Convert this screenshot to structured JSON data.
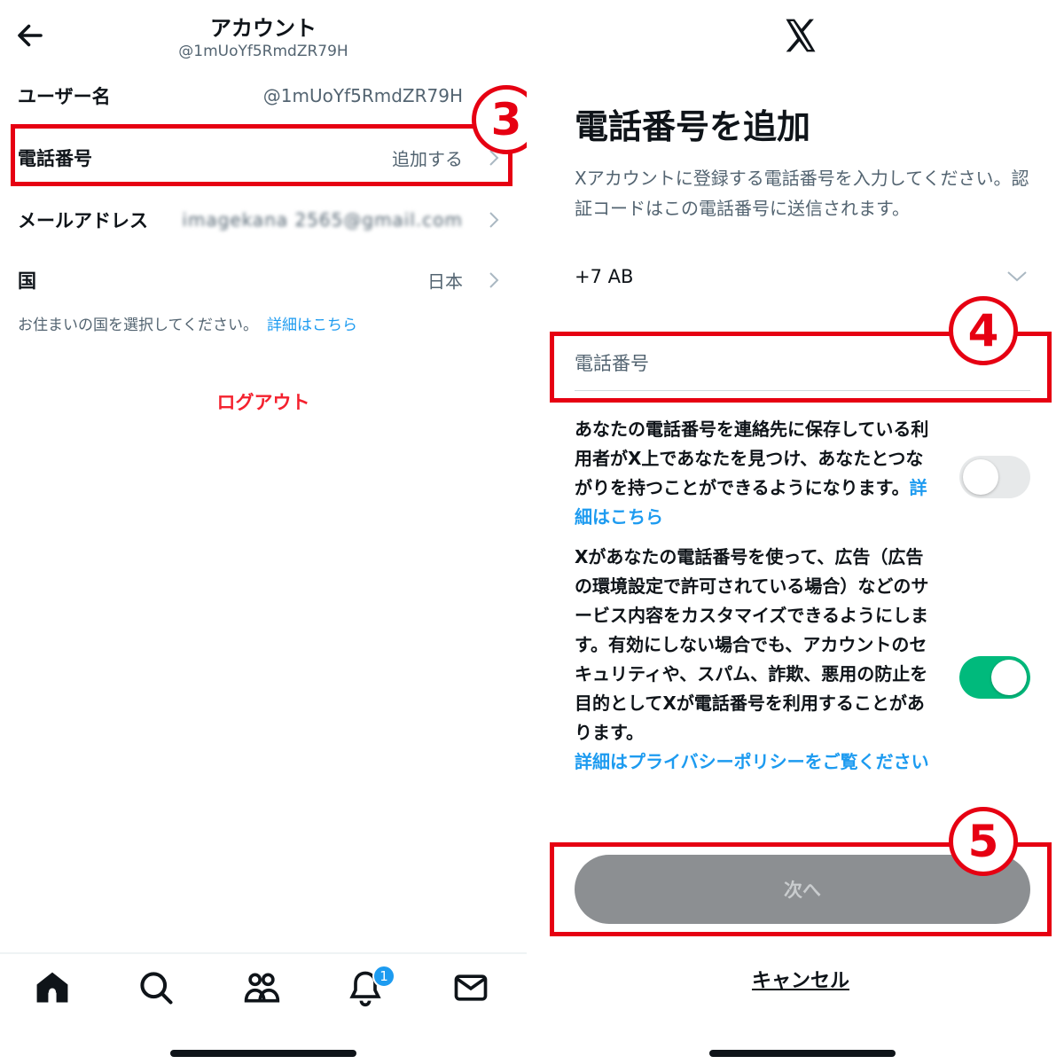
{
  "left": {
    "header": {
      "title": "アカウント",
      "handle": "@1mUoYf5RmdZR79H"
    },
    "rows": [
      {
        "label": "ユーザー名",
        "value": "@1mUoYf5RmdZR79H"
      },
      {
        "label": "電話番号",
        "value": "追加する"
      },
      {
        "label": "メールアドレス",
        "value": "imagekana 2565@gmail.com"
      },
      {
        "label": "国",
        "value": "日本"
      }
    ],
    "country_note": "お住まいの国を選択してください。",
    "country_link": "詳細はこちら",
    "logout": "ログアウト",
    "notification_count": "1"
  },
  "steps": {
    "three": "3",
    "four": "4",
    "five": "5"
  },
  "right": {
    "title": "電話番号を追加",
    "description": "Xアカウントに登録する電話番号を入力してください。認証コードはこの電話番号に送信されます。",
    "country_code": "+7 AB",
    "phone_placeholder": "電話番号",
    "option1_text": "あなたの電話番号を連絡先に保存している利用者がX上であなたを見つけ、あなたとつながりを持つことができるようになります。",
    "option1_link": "詳細はこちら",
    "option2_text": "Xがあなたの電話番号を使って、広告（広告の環境設定で許可されている場合）などのサービス内容をカスタマイズできるようにします。有効にしない場合でも、アカウントのセキュリティや、スパム、詐欺、悪用の防止を目的としてXが電話番号を利用することがあります。",
    "option2_link": "詳細はプライバシーポリシーをご覧ください",
    "next": "次へ",
    "cancel": "キャンセル"
  },
  "colors": {
    "accent": "#1d9bf0",
    "highlight": "#e60012",
    "toggle_on": "#00ba7c",
    "logout": "#f4212e"
  }
}
